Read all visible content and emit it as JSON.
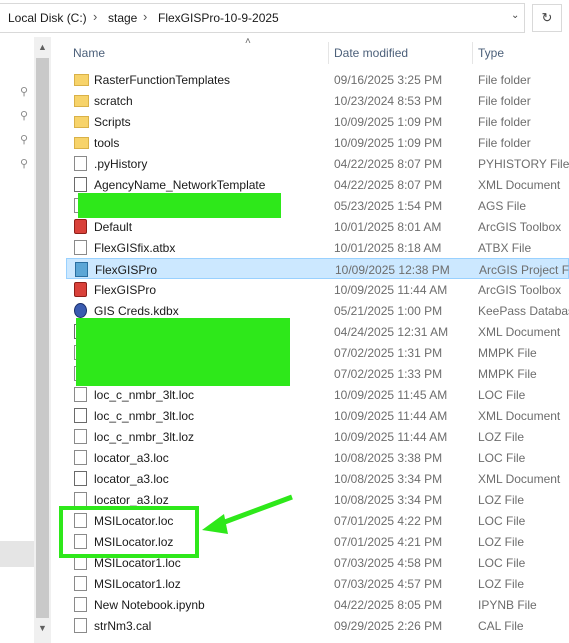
{
  "breadcrumb": {
    "items": [
      "Local Disk (C:)",
      "stage",
      "FlexGISPro-10-9-2025"
    ],
    "separator": "›",
    "dropdown_icon": "chevron-down-icon",
    "refresh_icon": "refresh-icon"
  },
  "columns": {
    "name": "Name",
    "date": "Date modified",
    "type": "Type"
  },
  "files": [
    {
      "name": "RasterFunctionTemplates",
      "date": "09/16/2025 3:25 PM",
      "type": "File folder",
      "icon": "folder"
    },
    {
      "name": "scratch",
      "date": "10/23/2024 8:53 PM",
      "type": "File folder",
      "icon": "folder"
    },
    {
      "name": "Scripts",
      "date": "10/09/2025 1:09 PM",
      "type": "File folder",
      "icon": "folder"
    },
    {
      "name": "tools",
      "date": "10/09/2025 1:09 PM",
      "type": "File folder",
      "icon": "folder"
    },
    {
      "name": ".pyHistory",
      "date": "04/22/2025 8:07 PM",
      "type": "PYHISTORY File",
      "icon": "doc"
    },
    {
      "name": "AgencyName_NetworkTemplate",
      "date": "04/22/2025 8:07 PM",
      "type": "XML Document",
      "icon": "xml"
    },
    {
      "name": "",
      "date": "05/23/2025 1:54 PM",
      "type": "AGS File",
      "icon": "doc"
    },
    {
      "name": "Default",
      "date": "10/01/2025 8:01 AM",
      "type": "ArcGIS Toolbox",
      "icon": "toolbox"
    },
    {
      "name": "FlexGISfix.atbx",
      "date": "10/01/2025 8:18 AM",
      "type": "ATBX File",
      "icon": "doc"
    },
    {
      "name": "FlexGISPro",
      "date": "10/09/2025 12:38 PM",
      "type": "ArcGIS Project File",
      "icon": "proj",
      "selected": true
    },
    {
      "name": "FlexGISPro",
      "date": "10/09/2025 11:44 AM",
      "type": "ArcGIS Toolbox",
      "icon": "toolbox"
    },
    {
      "name": "GIS Creds.kdbx",
      "date": "05/21/2025 1:00 PM",
      "type": "KeePass Database",
      "icon": "keepass"
    },
    {
      "name": "",
      "date": "04/24/2025 12:31 AM",
      "type": "XML Document",
      "icon": "xml"
    },
    {
      "name": "",
      "date": "07/02/2025 1:31 PM",
      "type": "MMPK File",
      "icon": "doc"
    },
    {
      "name": "",
      "date": "07/02/2025 1:33 PM",
      "type": "MMPK File",
      "icon": "doc"
    },
    {
      "name": "loc_c_nmbr_3lt.loc",
      "date": "10/09/2025 11:45 AM",
      "type": "LOC File",
      "icon": "doc"
    },
    {
      "name": "loc_c_nmbr_3lt.loc",
      "date": "10/09/2025 11:44 AM",
      "type": "XML Document",
      "icon": "xml"
    },
    {
      "name": "loc_c_nmbr_3lt.loz",
      "date": "10/09/2025 11:44 AM",
      "type": "LOZ File",
      "icon": "doc"
    },
    {
      "name": "locator_a3.loc",
      "date": "10/08/2025 3:38 PM",
      "type": "LOC File",
      "icon": "doc"
    },
    {
      "name": "locator_a3.loc",
      "date": "10/08/2025 3:34 PM",
      "type": "XML Document",
      "icon": "xml"
    },
    {
      "name": "locator_a3.loz",
      "date": "10/08/2025 3:34 PM",
      "type": "LOZ File",
      "icon": "doc"
    },
    {
      "name": "MSILocator.loc",
      "date": "07/01/2025 4:22 PM",
      "type": "LOC File",
      "icon": "doc"
    },
    {
      "name": "MSILocator.loz",
      "date": "07/01/2025 4:21 PM",
      "type": "LOZ File",
      "icon": "doc"
    },
    {
      "name": "MSILocator1.loc",
      "date": "07/03/2025 4:58 PM",
      "type": "LOC File",
      "icon": "doc"
    },
    {
      "name": "MSILocator1.loz",
      "date": "07/03/2025 4:57 PM",
      "type": "LOZ File",
      "icon": "doc"
    },
    {
      "name": "New Notebook.ipynb",
      "date": "04/22/2025 8:05 PM",
      "type": "IPYNB File",
      "icon": "doc"
    },
    {
      "name": "strNm3.cal",
      "date": "09/29/2025 2:26 PM",
      "type": "CAL File",
      "icon": "doc"
    }
  ],
  "annotation": {
    "highlight_color": "#2ee81a",
    "arrow": "pointing-arrow-icon"
  }
}
